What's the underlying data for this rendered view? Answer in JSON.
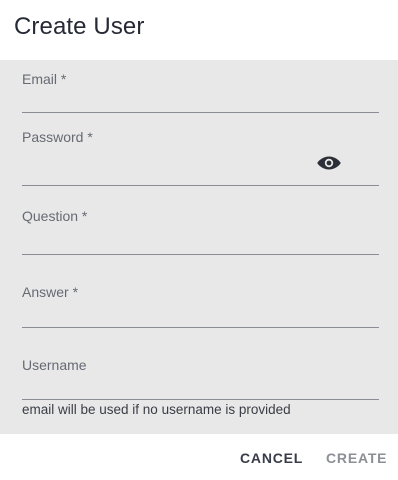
{
  "dialog": {
    "title": "Create User"
  },
  "form": {
    "email": {
      "label": "Email *",
      "value": ""
    },
    "password": {
      "label": "Password *",
      "value": "",
      "toggle_icon": "eye-icon"
    },
    "question": {
      "label": "Question *",
      "value": ""
    },
    "answer": {
      "label": "Answer *",
      "value": ""
    },
    "username": {
      "label": "Username",
      "value": "",
      "hint": "email will be used if no username is provided"
    }
  },
  "actions": {
    "cancel_label": "CANCEL",
    "create_label": "CREATE"
  },
  "colors": {
    "content_bg": "#e8e8e8",
    "title": "#262a36",
    "create_disabled": "#8c8f96"
  }
}
